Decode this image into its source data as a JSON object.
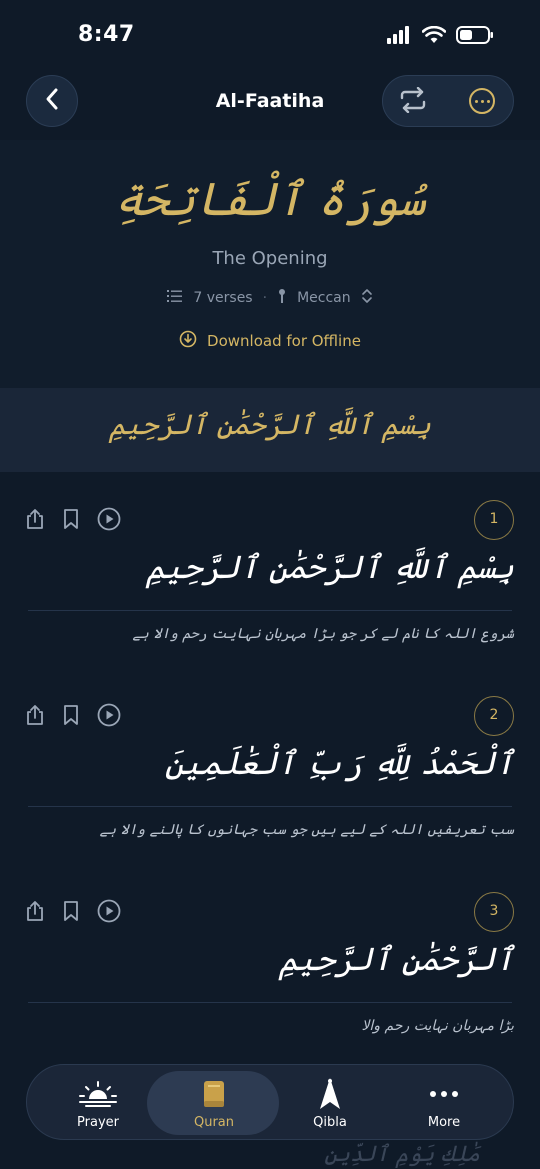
{
  "status": {
    "time": "8:47"
  },
  "header": {
    "title": "Al-Faatiha"
  },
  "surah": {
    "arabic_name": "سُورَةُ ٱلْفَاتِحَةِ",
    "english_name": "The Opening",
    "verses_count": "7 verses",
    "revelation": "Meccan",
    "download_label": "Download for Offline"
  },
  "bismillah": "بِسْمِ ٱللَّهِ ٱلرَّحْمَٰنِ ٱلرَّحِيمِ",
  "verses": [
    {
      "number": "1",
      "arabic": "بِسْمِ ٱللَّهِ ٱلرَّحْمَٰنِ ٱلرَّحِيمِ",
      "translation": "شروع اللہ کا نام لے کر جو بڑا مہربان نہایت رحم والا ہے"
    },
    {
      "number": "2",
      "arabic": "ٱلْحَمْدُ لِلَّهِ رَبِّ ٱلْعَٰلَمِينَ",
      "translation": "سب تعریفیں اللہ کے لیے ہیں جو سب جہانوں کا پالنے والا ہے"
    },
    {
      "number": "3",
      "arabic": "ٱلرَّحْمَٰنِ ٱلرَّحِيمِ",
      "translation": "بڑا مہربان نہایت رحم والا"
    }
  ],
  "next_verse_partial": "مَٰلِكِ يَوْمِ ٱلدِّينِ",
  "tabs": [
    {
      "label": "Prayer",
      "icon": "sunrise-icon"
    },
    {
      "label": "Quran",
      "icon": "book-icon",
      "active": true
    },
    {
      "label": "Qibla",
      "icon": "compass-arrow-icon"
    },
    {
      "label": "More",
      "icon": "more-dots-icon"
    }
  ],
  "colors": {
    "accent_gold": "#d4b664",
    "background": "#0f1a28"
  }
}
